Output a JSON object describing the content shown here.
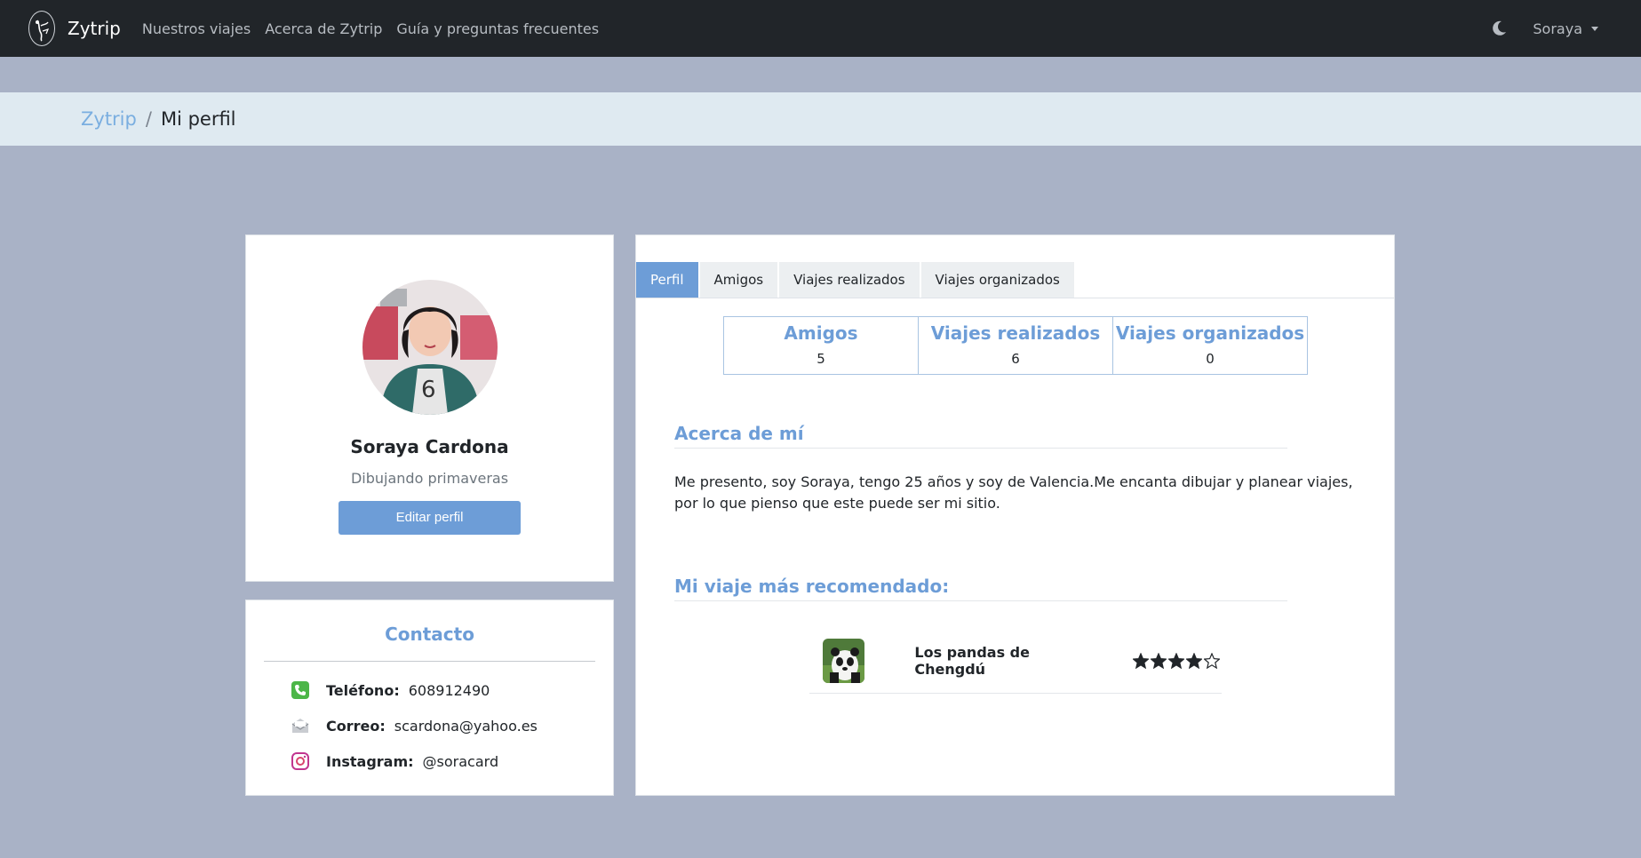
{
  "navbar": {
    "brand": "Zytrip",
    "links": [
      "Nuestros viajes",
      "Acerca de Zytrip",
      "Guía y preguntas frecuentes"
    ],
    "user": "Soraya"
  },
  "breadcrumb": {
    "home": "Zytrip",
    "separator": "/",
    "current": "Mi perfil"
  },
  "profile": {
    "name": "Soraya Cardona",
    "tagline": "Dibujando primaveras",
    "edit_label": "Editar perfil"
  },
  "contact": {
    "title": "Contacto",
    "items": [
      {
        "icon": "phone-icon",
        "label": "Teléfono:",
        "value": "608912490"
      },
      {
        "icon": "mail-icon",
        "label": "Correo:",
        "value": "scardona@yahoo.es"
      },
      {
        "icon": "instagram-icon",
        "label": "Instagram:",
        "value": "@soracard"
      }
    ]
  },
  "tabs": [
    "Perfil",
    "Amigos",
    "Viajes realizados",
    "Viajes organizados"
  ],
  "stats": [
    {
      "label": "Amigos",
      "value": "5"
    },
    {
      "label": "Viajes realizados",
      "value": "6"
    },
    {
      "label": "Viajes organizados",
      "value": "0"
    }
  ],
  "about": {
    "title": "Acerca de mí",
    "text": "Me presento, soy Soraya, tengo 25 años y soy de Valencia.Me encanta dibujar y planear viajes, por lo que pienso que este puede ser mi sitio."
  },
  "recommended": {
    "title": "Mi viaje más recomendado:",
    "trip_name": "Los pandas de Chengdú",
    "rating": 4,
    "rating_max": 5
  },
  "colors": {
    "accent": "#6d9dd7",
    "navbar": "#212529",
    "background": "#a9b2c6",
    "breadcrumb": "#dfeaf1"
  }
}
